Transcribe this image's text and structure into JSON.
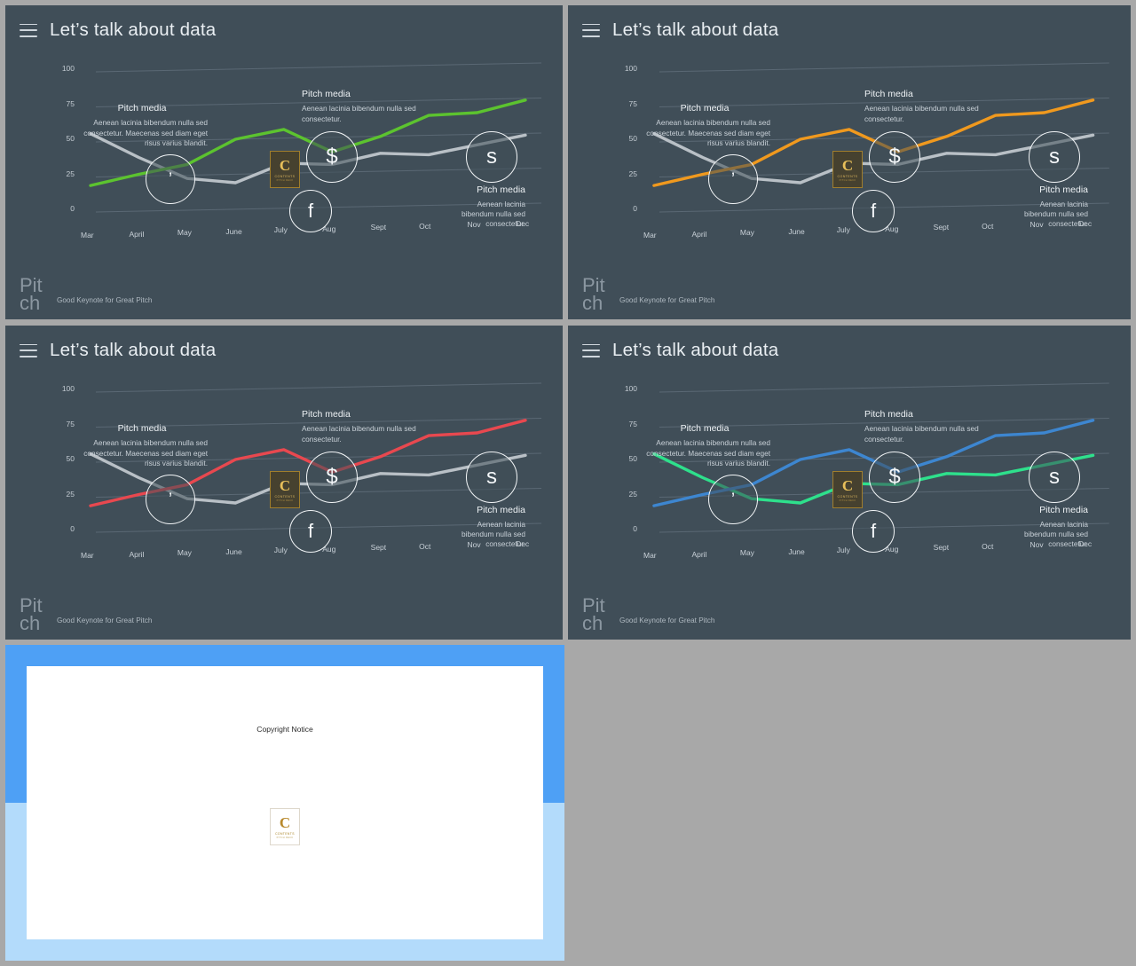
{
  "deck": {
    "slide_title": "Let’s talk about data",
    "menu_icon": "hamburger-icon",
    "footer_brand": "Pitch",
    "footer_tagline": "Good Keynote for Great Pitch",
    "badge": {
      "letter": "C",
      "line1": "CONTENTS",
      "line2": "PITCH DECK"
    }
  },
  "callouts": {
    "left": {
      "title": "Pitch media",
      "body": "Aenean lacinia bibendum nulla sed consectetur. Maecenas sed diam eget risus varius blandit."
    },
    "top": {
      "title": "Pitch media",
      "body": "Aenean lacinia bibendum nulla sed consectetur."
    },
    "right": {
      "title": "Pitch media",
      "body": "Aenean lacinia bibendum nulla sed consectetur."
    }
  },
  "markers": [
    {
      "name": "twitter-marker",
      "glyph": "’"
    },
    {
      "name": "dollar-marker",
      "glyph": "$"
    },
    {
      "name": "facebook-marker",
      "glyph": "f"
    },
    {
      "name": "skype-marker",
      "glyph": "s"
    }
  ],
  "copyright_slide": {
    "title": "Copyright Notice",
    "logo": {
      "letter": "C",
      "line1": "CONTENTS",
      "line2": "PITCH DECK"
    },
    "band_top_color": "#4ea0f5",
    "band_bottom_color": "#b3dbfb"
  },
  "chart_data": {
    "type": "line",
    "title": "Let’s talk about data",
    "xlabel": "",
    "ylabel": "",
    "grid": true,
    "legend": "none",
    "ylim": [
      0,
      100
    ],
    "yticks": [
      0,
      25,
      50,
      75,
      100
    ],
    "categories": [
      "Mar",
      "April",
      "May",
      "June",
      "July",
      "Aug",
      "Sept",
      "Oct",
      "Nov",
      "Dec"
    ],
    "panels": [
      {
        "panel": 1,
        "series": [
          {
            "name": "gray",
            "color": "#b9c0c6",
            "values": [
              54,
              37,
              22,
              19,
              33,
              32,
              40,
              39,
              46,
              53
            ]
          },
          {
            "name": "green",
            "color": "#5cc32f",
            "values": [
              17,
              25,
              32,
              50,
              57,
              41,
              52,
              67,
              69,
              78
            ]
          }
        ]
      },
      {
        "panel": 2,
        "series": [
          {
            "name": "gray",
            "color": "#b9c0c6",
            "values": [
              54,
              37,
              22,
              19,
              33,
              32,
              40,
              39,
              46,
              53
            ]
          },
          {
            "name": "orange",
            "color": "#f0991e",
            "values": [
              17,
              25,
              32,
              50,
              57,
              41,
              52,
              67,
              69,
              78
            ]
          }
        ]
      },
      {
        "panel": 3,
        "series": [
          {
            "name": "gray",
            "color": "#b9c0c6",
            "values": [
              54,
              37,
              22,
              19,
              33,
              32,
              40,
              39,
              46,
              53
            ]
          },
          {
            "name": "red",
            "color": "#e8484f",
            "values": [
              17,
              25,
              32,
              50,
              57,
              41,
              52,
              67,
              69,
              78
            ]
          }
        ]
      },
      {
        "panel": 4,
        "series": [
          {
            "name": "teal",
            "color": "#2ee08c",
            "values": [
              54,
              37,
              22,
              19,
              33,
              32,
              40,
              39,
              46,
              53
            ]
          },
          {
            "name": "blue",
            "color": "#3d86d0",
            "values": [
              17,
              25,
              32,
              50,
              57,
              41,
              52,
              67,
              69,
              78
            ]
          }
        ]
      }
    ]
  }
}
